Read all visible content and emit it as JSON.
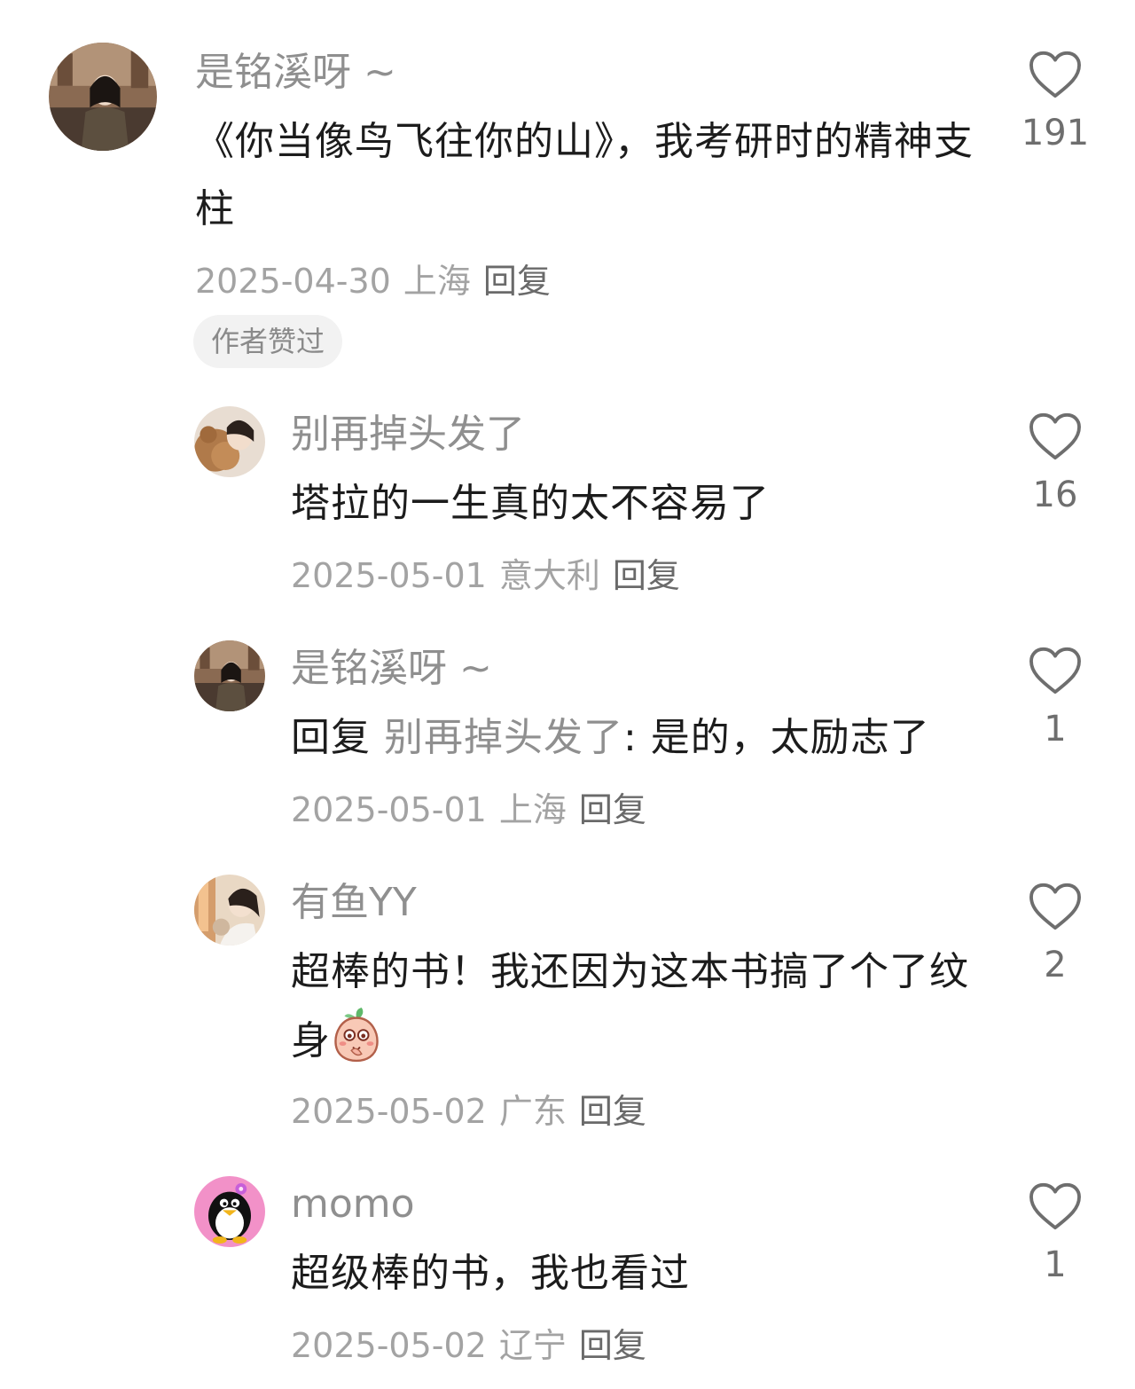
{
  "comments": [
    {
      "username": "是铭溪呀 ~",
      "text": "《你当像鸟飞往你的山》，我考研时的精神支柱",
      "date": "2025-04-30",
      "location": "上海",
      "reply_label": "回复",
      "badge": "作者赞过",
      "likes": "191",
      "avatar_icon": "avatar-photo-icon"
    },
    {
      "username": "别再掉头发了",
      "text": "塔拉的一生真的太不容易了",
      "date": "2025-05-01",
      "location": "意大利",
      "reply_label": "回复",
      "likes": "16",
      "avatar_icon": "avatar-photo-icon"
    },
    {
      "username": "是铭溪呀 ~",
      "reply_prefix": "回复",
      "reply_target": "别再掉头发了",
      "text": ": 是的，太励志了",
      "date": "2025-05-01",
      "location": "上海",
      "reply_label": "回复",
      "likes": "1",
      "avatar_icon": "avatar-photo-icon"
    },
    {
      "username": "有鱼YY",
      "text": "超棒的书！我还因为这本书搞了个了纹身",
      "emoji": "peach-emoji-icon",
      "date": "2025-05-02",
      "location": "广东",
      "reply_label": "回复",
      "likes": "2",
      "avatar_icon": "avatar-photo-icon"
    },
    {
      "username": "momo",
      "text": "超级棒的书，我也看过",
      "date": "2025-05-02",
      "location": "辽宁",
      "reply_label": "回复",
      "likes": "1",
      "avatar_icon": "penguin-avatar-icon"
    }
  ],
  "colors": {
    "text": "#1c1c1c",
    "muted": "#8f8f8f",
    "badge_bg": "#f2f2f2",
    "heart": "#6e6e6e"
  }
}
